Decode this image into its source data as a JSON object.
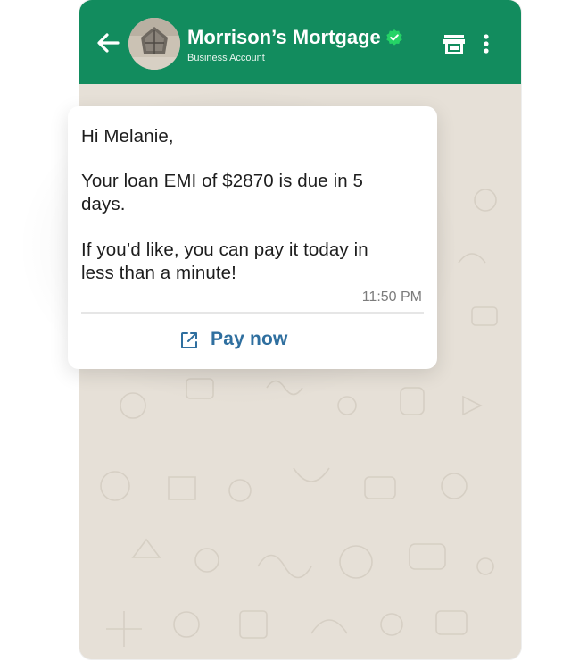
{
  "header": {
    "title": "Morrison’s Mortgage",
    "subtitle": "Business Account",
    "verified": true
  },
  "message": {
    "greeting": "Hi Melanie,",
    "body_line1": "Your loan EMI of $2870 is due in 5",
    "body_line2": "days.",
    "body_line3": "If you’d like, you can pay it today in",
    "body_line4": "less than a minute!",
    "time": "11:50 PM",
    "action_label": "Pay now"
  },
  "icons": [
    "back-arrow-icon",
    "avatar",
    "verified-icon",
    "store-icon",
    "more-vert-icon",
    "external-link-icon"
  ],
  "colors": {
    "header": "#128c5e",
    "wallpaper": "#e6e0d7",
    "verified": "#25d366",
    "action": "#2f6f9f"
  }
}
